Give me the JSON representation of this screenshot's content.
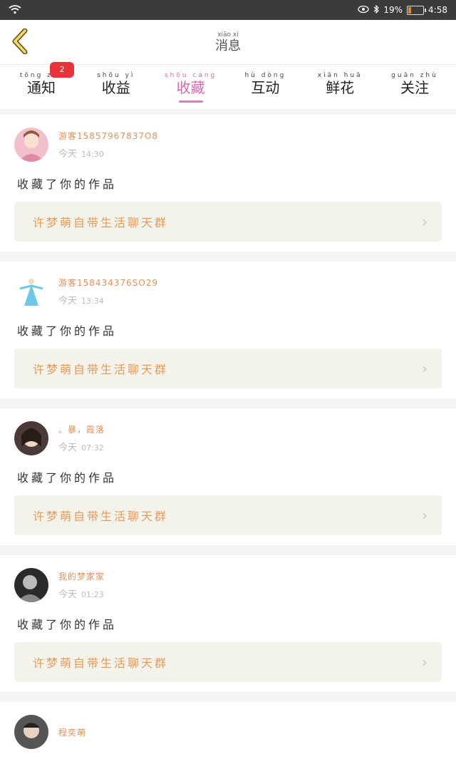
{
  "status_bar": {
    "battery": "19%",
    "time": "4:58"
  },
  "header": {
    "title": "消息",
    "title_pinyin": "xiāo xi"
  },
  "tabs": [
    {
      "label": "通知",
      "pinyin": "tōng zhī",
      "badge": "2",
      "active": false
    },
    {
      "label": "收益",
      "pinyin": "shōu yì",
      "active": false
    },
    {
      "label": "收藏",
      "pinyin": "shōu cáng",
      "active": true
    },
    {
      "label": "互动",
      "pinyin": "hù dòng",
      "active": false
    },
    {
      "label": "鲜花",
      "pinyin": "xiān huā",
      "active": false
    },
    {
      "label": "关注",
      "pinyin": "guān zhù",
      "active": false
    }
  ],
  "messages": [
    {
      "name": "游客15857967837O8",
      "meta_label": "今天",
      "time": "14:30",
      "action": "收藏了你的作品",
      "work": "许梦萌自带生活聊天群",
      "avatar_color": "#f2c0cc",
      "avatar_icon": "user-avatar"
    },
    {
      "name": "游客158434376SO29",
      "meta_label": "今天",
      "time": "13:34",
      "action": "收藏了你的作品",
      "work": "许梦萌自带生活聊天群",
      "avatar_color": "#6ec7e8",
      "avatar_icon": "dancer-avatar"
    },
    {
      "name": "。暴，霞落",
      "meta_label": "今天",
      "time": "07:32",
      "action": "收藏了你的作品",
      "work": "许梦萌自带生活聊天群",
      "avatar_color": "#4a3a3a",
      "avatar_icon": "user-avatar"
    },
    {
      "name": "我的梦家家",
      "meta_label": "今天",
      "time": "01:23",
      "action": "收藏了你的作品",
      "work": "许梦萌自带生活聊天群",
      "avatar_color": "#2a2a2a",
      "avatar_icon": "user-avatar"
    },
    {
      "name": "程奕萌",
      "meta_label": "",
      "time": "",
      "action": "",
      "work": "",
      "avatar_color": "#555555",
      "avatar_icon": "user-avatar"
    }
  ]
}
